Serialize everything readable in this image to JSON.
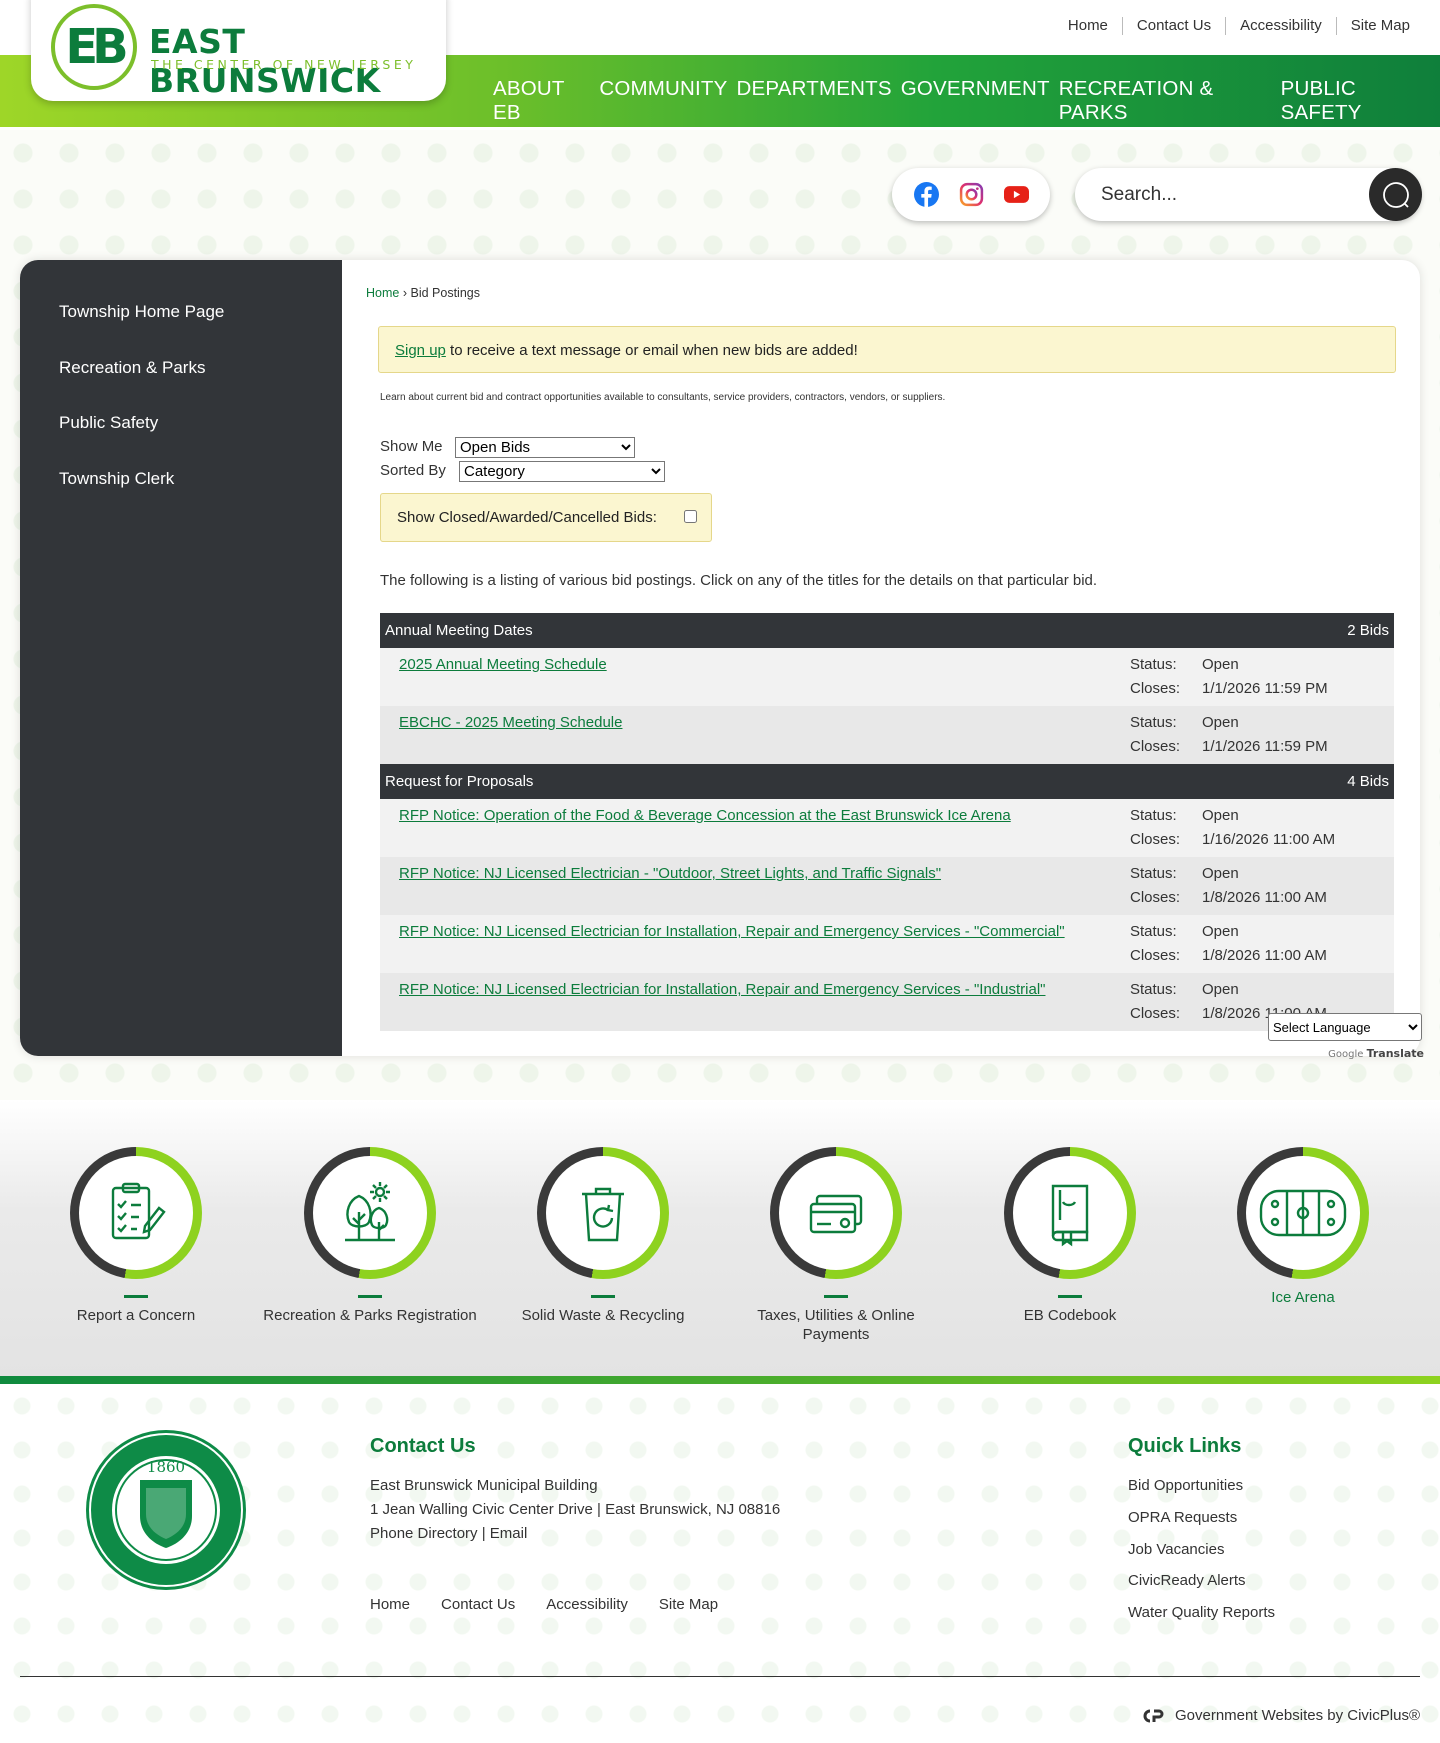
{
  "header": {
    "logo_name": "EAST BRUNSWICK",
    "logo_tagline": "THE CENTER OF NEW JERSEY",
    "logo_initials": "EB",
    "utility_nav": [
      "Home",
      "Contact Us",
      "Accessibility",
      "Site Map"
    ],
    "main_nav": [
      "ABOUT EB",
      "COMMUNITY",
      "DEPARTMENTS",
      "GOVERNMENT",
      "RECREATION & PARKS",
      "PUBLIC SAFETY"
    ]
  },
  "social": {
    "icons": [
      "facebook-icon",
      "instagram-icon",
      "youtube-icon"
    ]
  },
  "search": {
    "placeholder": "Search..."
  },
  "sidebar": {
    "items": [
      "Township Home Page",
      "Recreation & Parks",
      "Public Safety",
      "Township Clerk"
    ]
  },
  "breadcrumb": {
    "home": "Home",
    "separator": "›",
    "current": "Bid Postings"
  },
  "notice": {
    "link": "Sign up",
    "text": " to receive a text message or email when new bids are added!"
  },
  "intro": "Learn about current bid and contract opportunities available to consultants, service providers, contractors, vendors, or suppliers.",
  "filters": {
    "show_me_label": "Show Me",
    "show_me_value": "Open Bids",
    "sorted_by_label": "Sorted By",
    "sorted_by_value": "Category",
    "closed_label": "Show Closed/Awarded/Cancelled Bids:"
  },
  "listing_text": "The following is a listing of various bid postings. Click on any of the titles for the details on that particular bid.",
  "categories": [
    {
      "name": "Annual Meeting Dates",
      "count": "2 Bids",
      "bids": [
        {
          "title": "2025 Annual Meeting Schedule",
          "status_label": "Status:",
          "status": "Open",
          "closes_label": "Closes:",
          "closes": "1/1/2026 11:59 PM"
        },
        {
          "title": "EBCHC - 2025 Meeting Schedule",
          "status_label": "Status:",
          "status": "Open",
          "closes_label": "Closes:",
          "closes": "1/1/2026 11:59 PM"
        }
      ]
    },
    {
      "name": "Request for Proposals",
      "count": "4 Bids",
      "bids": [
        {
          "title": "RFP Notice: Operation of the Food & Beverage Concession at the East Brunswick Ice Arena",
          "status_label": "Status:",
          "status": "Open",
          "closes_label": "Closes:",
          "closes": "1/16/2026 11:00 AM"
        },
        {
          "title": "RFP Notice: NJ Licensed Electrician - \"Outdoor, Street Lights, and Traffic Signals\"",
          "status_label": "Status:",
          "status": "Open",
          "closes_label": "Closes:",
          "closes": "1/8/2026 11:00 AM"
        },
        {
          "title": "RFP Notice: NJ Licensed Electrician for Installation, Repair and Emergency Services - \"Commercial\"",
          "status_label": "Status:",
          "status": "Open",
          "closes_label": "Closes:",
          "closes": "1/8/2026 11:00 AM"
        },
        {
          "title": "RFP Notice: NJ Licensed Electrician for Installation, Repair and Emergency Services - \"Industrial\"",
          "status_label": "Status:",
          "status": "Open",
          "closes_label": "Closes:",
          "closes": "1/8/2026 11:00 AM"
        }
      ]
    }
  ],
  "translate": {
    "select_label": "Select Language",
    "powered_prefix": "Google",
    "powered_suffix": "Translate"
  },
  "quick_links": [
    {
      "label": "Report a Concern",
      "icon": "checklist-icon"
    },
    {
      "label": "Recreation & Parks Registration",
      "icon": "tree-icon"
    },
    {
      "label": "Solid Waste & Recycling",
      "icon": "recycle-bin-icon"
    },
    {
      "label": "Taxes, Utilities & Online Payments",
      "icon": "credit-card-icon"
    },
    {
      "label": "EB Codebook",
      "icon": "book-icon"
    },
    {
      "label": "Ice Arena",
      "icon": "hockey-rink-icon"
    }
  ],
  "footer": {
    "seal_year": "1860",
    "contact_heading": "Contact Us",
    "contact_lines": [
      "East Brunswick Municipal Building",
      "1 Jean Walling Civic Center Drive | East Brunswick, NJ 08816",
      "Phone Directory | Email"
    ],
    "links": [
      "Home",
      "Contact Us",
      "Accessibility",
      "Site Map"
    ],
    "quick_heading": "Quick Links",
    "quick_links": [
      "Bid Opportunities",
      "OPRA Requests",
      "Job Vacancies",
      "CivicReady Alerts",
      "Water Quality Reports"
    ],
    "credit": "Government Websites by CivicPlus®"
  },
  "colors": {
    "brand_green": "#0c7c3c",
    "lime": "#8ed21f",
    "dark": "#323539",
    "notice_bg": "#fbf6d0"
  }
}
